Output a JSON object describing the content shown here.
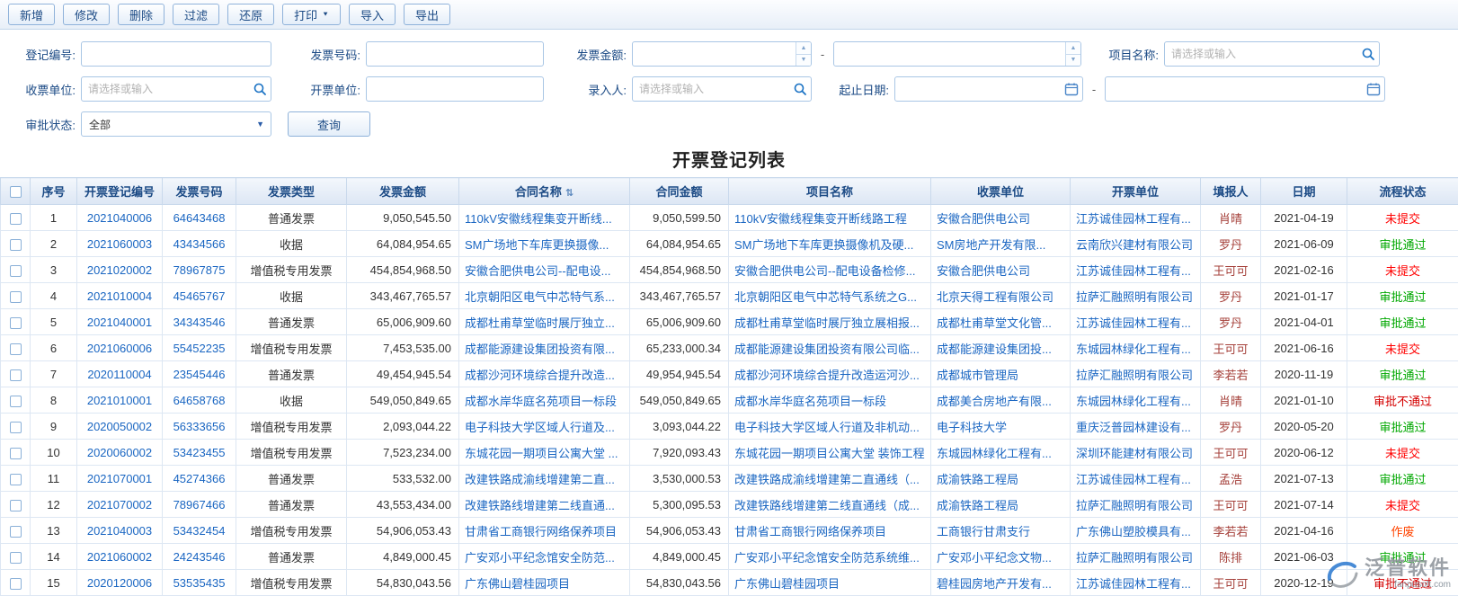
{
  "toolbar": {
    "add": "新增",
    "modify": "修改",
    "delete": "删除",
    "filter": "过滤",
    "restore": "还原",
    "print": "打印",
    "import": "导入",
    "export": "导出"
  },
  "filters": {
    "registration_no_label": "登记编号:",
    "invoice_no_label": "发票号码:",
    "invoice_amount_label": "发票金额:",
    "project_name_label": "项目名称:",
    "receiving_unit_label": "收票单位:",
    "invoicing_unit_label": "开票单位:",
    "entry_person_label": "录入人:",
    "date_range_label": "起止日期:",
    "approval_status_label": "审批状态:",
    "approval_status_value": "全部",
    "select_placeholder": "请选择或输入",
    "range_separator": "-",
    "query_button": "查询"
  },
  "icons": {
    "sort": "⇅",
    "print_caret": "▼",
    "dropdown_caret": "▼",
    "spinner_up": "▲",
    "spinner_down": "▼"
  },
  "colors": {
    "link": "#1a66c2",
    "label": "#1b4a85",
    "header-text": "#1b4a85",
    "toolbar-text": "#1b4a85",
    "filler": "#a5403a"
  },
  "table": {
    "title": "开票登记列表",
    "columns": [
      "序号",
      "开票登记编号",
      "发票号码",
      "发票类型",
      "发票金额",
      "合同名称",
      "合同金额",
      "项目名称",
      "收票单位",
      "开票单位",
      "填报人",
      "日期",
      "流程状态"
    ],
    "status_colors": {
      "未提交": "#ff0000",
      "审批通过": "#00a800",
      "审批不通过": "#d40000",
      "作废": "#ff4400"
    },
    "rows": [
      {
        "no": "1",
        "reg_no": "2021040006",
        "invoice_no": "64643468",
        "type": "普通发票",
        "amount": "9,050,545.50",
        "contract": "110kV安徽线程集变开断线...",
        "contract_amount": "9,050,599.50",
        "project": "110kV安徽线程集变开断线路工程",
        "receiver": "安徽合肥供电公司",
        "issuer": "江苏诚佳园林工程有...",
        "filler": "肖晴",
        "date": "2021-04-19",
        "status": "未提交"
      },
      {
        "no": "2",
        "reg_no": "2021060003",
        "invoice_no": "43434566",
        "type": "收据",
        "amount": "64,084,954.65",
        "contract": "SM广场地下车库更换摄像...",
        "contract_amount": "64,084,954.65",
        "project": "SM广场地下车库更换摄像机及硬...",
        "receiver": "SM房地产开发有限...",
        "issuer": "云南欣兴建材有限公司",
        "filler": "罗丹",
        "date": "2021-06-09",
        "status": "审批通过"
      },
      {
        "no": "3",
        "reg_no": "2021020002",
        "invoice_no": "78967875",
        "type": "增值税专用发票",
        "amount": "454,854,968.50",
        "contract": "安徽合肥供电公司--配电设...",
        "contract_amount": "454,854,968.50",
        "project": "安徽合肥供电公司--配电设备检修...",
        "receiver": "安徽合肥供电公司",
        "issuer": "江苏诚佳园林工程有...",
        "filler": "王可可",
        "date": "2021-02-16",
        "status": "未提交"
      },
      {
        "no": "4",
        "reg_no": "2021010004",
        "invoice_no": "45465767",
        "type": "收据",
        "amount": "343,467,765.57",
        "contract": "北京朝阳区电气中芯特气系...",
        "contract_amount": "343,467,765.57",
        "project": "北京朝阳区电气中芯特气系统之G...",
        "receiver": "北京天得工程有限公司",
        "issuer": "拉萨汇融照明有限公司",
        "filler": "罗丹",
        "date": "2021-01-17",
        "status": "审批通过"
      },
      {
        "no": "5",
        "reg_no": "2021040001",
        "invoice_no": "34343546",
        "type": "普通发票",
        "amount": "65,006,909.60",
        "contract": "成都杜甫草堂临时展厅独立...",
        "contract_amount": "65,006,909.60",
        "project": "成都杜甫草堂临时展厅独立展相报...",
        "receiver": "成都杜甫草堂文化管...",
        "issuer": "江苏诚佳园林工程有...",
        "filler": "罗丹",
        "date": "2021-04-01",
        "status": "审批通过"
      },
      {
        "no": "6",
        "reg_no": "2021060006",
        "invoice_no": "55452235",
        "type": "增值税专用发票",
        "amount": "7,453,535.00",
        "contract": "成都能源建设集团投资有限...",
        "contract_amount": "65,233,000.34",
        "project": "成都能源建设集团投资有限公司临...",
        "receiver": "成都能源建设集团投...",
        "issuer": "东城园林绿化工程有...",
        "filler": "王可可",
        "date": "2021-06-16",
        "status": "未提交"
      },
      {
        "no": "7",
        "reg_no": "2020110004",
        "invoice_no": "23545446",
        "type": "普通发票",
        "amount": "49,454,945.54",
        "contract": "成都沙河环境综合提升改造...",
        "contract_amount": "49,954,945.54",
        "project": "成都沙河环境综合提升改造运河沙...",
        "receiver": "成都城市管理局",
        "issuer": "拉萨汇融照明有限公司",
        "filler": "李若若",
        "date": "2020-11-19",
        "status": "审批通过"
      },
      {
        "no": "8",
        "reg_no": "2021010001",
        "invoice_no": "64658768",
        "type": "收据",
        "amount": "549,050,849.65",
        "contract": "成都水岸华庭名苑项目一标段",
        "contract_amount": "549,050,849.65",
        "project": "成都水岸华庭名苑项目一标段",
        "receiver": "成都美合房地产有限...",
        "issuer": "东城园林绿化工程有...",
        "filler": "肖晴",
        "date": "2021-01-10",
        "status": "审批不通过"
      },
      {
        "no": "9",
        "reg_no": "2020050002",
        "invoice_no": "56333656",
        "type": "增值税专用发票",
        "amount": "2,093,044.22",
        "contract": "电子科技大学区域人行道及...",
        "contract_amount": "3,093,044.22",
        "project": "电子科技大学区域人行道及非机动...",
        "receiver": "电子科技大学",
        "issuer": "重庆泛普园林建设有...",
        "filler": "罗丹",
        "date": "2020-05-20",
        "status": "审批通过"
      },
      {
        "no": "10",
        "reg_no": "2020060002",
        "invoice_no": "53423455",
        "type": "增值税专用发票",
        "amount": "7,523,234.00",
        "contract": "东城花园一期项目公寓大堂 ...",
        "contract_amount": "7,920,093.43",
        "project": "东城花园一期项目公寓大堂 装饰工程",
        "receiver": "东城园林绿化工程有...",
        "issuer": "深圳环能建材有限公司",
        "filler": "王可可",
        "date": "2020-06-12",
        "status": "未提交"
      },
      {
        "no": "11",
        "reg_no": "2021070001",
        "invoice_no": "45274366",
        "type": "普通发票",
        "amount": "533,532.00",
        "contract": "改建铁路成渝线增建第二直...",
        "contract_amount": "3,530,000.53",
        "project": "改建铁路成渝线增建第二直通线（...",
        "receiver": "成渝铁路工程局",
        "issuer": "江苏诚佳园林工程有...",
        "filler": "孟浩",
        "date": "2021-07-13",
        "status": "审批通过"
      },
      {
        "no": "12",
        "reg_no": "2021070002",
        "invoice_no": "78967466",
        "type": "普通发票",
        "amount": "43,553,434.00",
        "contract": "改建铁路线增建第二线直通...",
        "contract_amount": "5,300,095.53",
        "project": "改建铁路线增建第二线直通线（成...",
        "receiver": "成渝铁路工程局",
        "issuer": "拉萨汇融照明有限公司",
        "filler": "王可可",
        "date": "2021-07-14",
        "status": "未提交"
      },
      {
        "no": "13",
        "reg_no": "2021040003",
        "invoice_no": "53432454",
        "type": "增值税专用发票",
        "amount": "54,906,053.43",
        "contract": "甘肃省工商银行网络保养项目",
        "contract_amount": "54,906,053.43",
        "project": "甘肃省工商银行网络保养项目",
        "receiver": "工商银行甘肃支行",
        "issuer": "广东佛山塑胶模具有...",
        "filler": "李若若",
        "date": "2021-04-16",
        "status": "作废"
      },
      {
        "no": "14",
        "reg_no": "2021060002",
        "invoice_no": "24243546",
        "type": "普通发票",
        "amount": "4,849,000.45",
        "contract": "广安邓小平纪念馆安全防范...",
        "contract_amount": "4,849,000.45",
        "project": "广安邓小平纪念馆安全防范系统维...",
        "receiver": "广安邓小平纪念文物...",
        "issuer": "拉萨汇融照明有限公司",
        "filler": "陈排",
        "date": "2021-06-03",
        "status": "审批通过"
      },
      {
        "no": "15",
        "reg_no": "2020120006",
        "invoice_no": "53535435",
        "type": "增值税专用发票",
        "amount": "54,830,043.56",
        "contract": "广东佛山碧桂园项目",
        "contract_amount": "54,830,043.56",
        "project": "广东佛山碧桂园项目",
        "receiver": "碧桂园房地产开发有...",
        "issuer": "江苏诚佳园林工程有...",
        "filler": "王可可",
        "date": "2020-12-19",
        "status": "审批不通过"
      }
    ]
  },
  "watermark": {
    "name": "泛普软件",
    "domain": "fanpusoft.com"
  }
}
